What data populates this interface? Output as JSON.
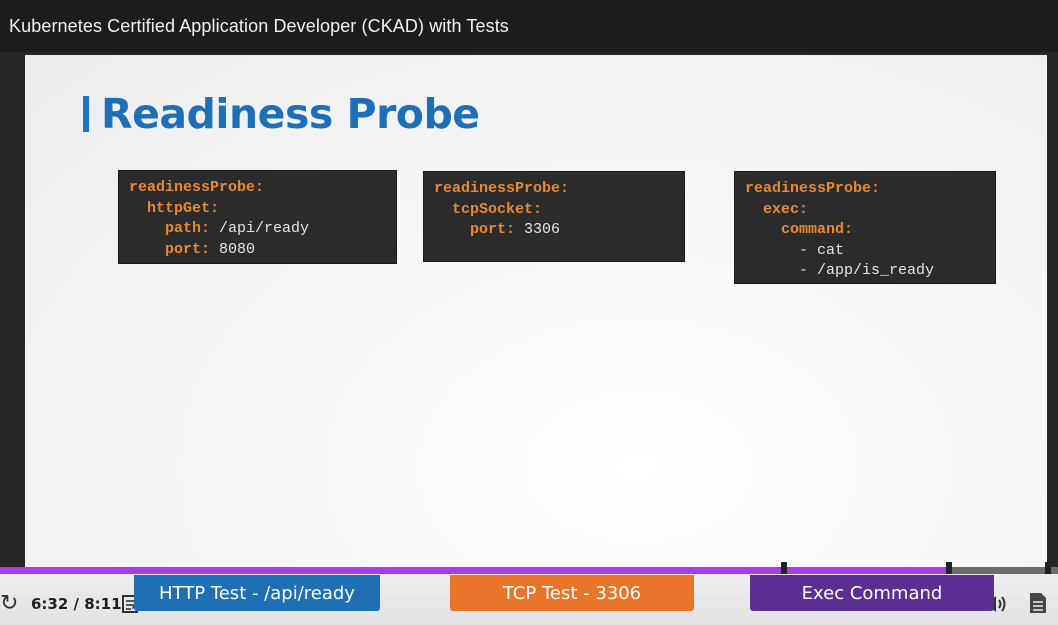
{
  "window": {
    "title": "Kubernetes Certified Application Developer (CKAD) with Tests"
  },
  "slide": {
    "title": "Readiness Probe",
    "boxes": [
      {
        "lines": [
          {
            "indent": "",
            "key": "readinessProbe:",
            "value": ""
          },
          {
            "indent": "  ",
            "key": "httpGet:",
            "value": ""
          },
          {
            "indent": "    ",
            "key": "path:",
            "value": " /api/ready"
          },
          {
            "indent": "    ",
            "key": "port:",
            "value": " 8080"
          }
        ]
      },
      {
        "lines": [
          {
            "indent": "",
            "key": "readinessProbe:",
            "value": ""
          },
          {
            "indent": "  ",
            "key": "tcpSocket:",
            "value": ""
          },
          {
            "indent": "    ",
            "key": "port:",
            "value": " 3306"
          }
        ]
      },
      {
        "lines": [
          {
            "indent": "",
            "key": "readinessProbe:",
            "value": ""
          },
          {
            "indent": "  ",
            "key": "exec:",
            "value": ""
          },
          {
            "indent": "    ",
            "key": "command:",
            "value": ""
          },
          {
            "indent": "",
            "key": "",
            "value": "      - cat"
          },
          {
            "indent": "",
            "key": "",
            "value": "      - /app/is_ready"
          }
        ]
      }
    ]
  },
  "player": {
    "current_time": "6:32",
    "duration": "8:11",
    "time_display": "6:32 / 8:11",
    "progress_fraction": 0.895,
    "progress_color": "#a93ee8",
    "icons": {
      "replay": "replay-icon",
      "notes": "notes-icon",
      "volume": "volume-icon",
      "transcript": "transcript-icon"
    },
    "chapters": [
      {
        "label": "HTTP Test - /api/ready",
        "color": "#1f6fb5"
      },
      {
        "label": "TCP Test - 3306",
        "color": "#e8752a"
      },
      {
        "label": "Exec Command",
        "color": "#5b2f91"
      }
    ]
  }
}
